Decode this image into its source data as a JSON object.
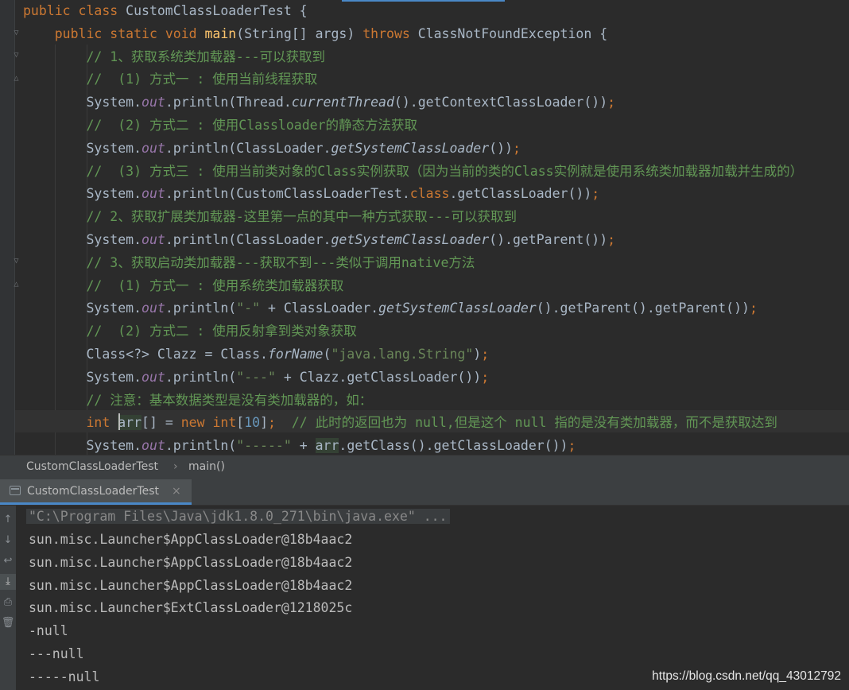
{
  "editor": {
    "lines": [
      {
        "t": [
          [
            "kw",
            "public class "
          ],
          [
            "",
            "CustomClassLoaderTest {"
          ]
        ]
      },
      {
        "t": [
          [
            "",
            "    "
          ],
          [
            "kw",
            "public static void "
          ],
          [
            "fn",
            "main"
          ],
          [
            "",
            "(String[] args) "
          ],
          [
            "kw",
            "throws "
          ],
          [
            "",
            "ClassNotFoundException {"
          ]
        ]
      },
      {
        "t": [
          [
            "",
            "        "
          ],
          [
            "cm",
            "// 1、获取系统类加载器---可以获取到"
          ]
        ]
      },
      {
        "t": [
          [
            "",
            "        "
          ],
          [
            "cm",
            "//  (1) 方式一 : 使用当前线程获取"
          ]
        ]
      },
      {
        "t": [
          [
            "",
            "        System."
          ],
          [
            "fld",
            "out"
          ],
          [
            "",
            ".println(Thread."
          ],
          [
            "it",
            "currentThread"
          ],
          [
            "",
            "().getContextClassLoader())"
          ],
          [
            "kw",
            ";"
          ]
        ]
      },
      {
        "t": [
          [
            "",
            "        "
          ],
          [
            "cm",
            "//  (2) 方式二 : 使用Classloader的静态方法获取"
          ]
        ]
      },
      {
        "t": [
          [
            "",
            "        System."
          ],
          [
            "fld",
            "out"
          ],
          [
            "",
            ".println(ClassLoader."
          ],
          [
            "it",
            "getSystemClassLoader"
          ],
          [
            "",
            "())"
          ],
          [
            "kw",
            ";"
          ]
        ]
      },
      {
        "t": [
          [
            "",
            "        "
          ],
          [
            "cm",
            "//  (3) 方式三 : 使用当前类对象的Class实例获取（因为当前的类的Class实例就是使用系统类加载器加载并生成的）"
          ]
        ]
      },
      {
        "t": [
          [
            "",
            "        System."
          ],
          [
            "fld",
            "out"
          ],
          [
            "",
            ".println(CustomClassLoaderTest."
          ],
          [
            "kw",
            "class"
          ],
          [
            "",
            ".getClassLoader())"
          ],
          [
            "kw",
            ";"
          ]
        ]
      },
      {
        "t": [
          [
            "",
            "        "
          ],
          [
            "cm",
            "// 2、获取扩展类加载器-这里第一点的其中一种方式获取---可以获取到"
          ]
        ]
      },
      {
        "t": [
          [
            "",
            "        System."
          ],
          [
            "fld",
            "out"
          ],
          [
            "",
            ".println(ClassLoader."
          ],
          [
            "it",
            "getSystemClassLoader"
          ],
          [
            "",
            "().getParent())"
          ],
          [
            "kw",
            ";"
          ]
        ]
      },
      {
        "t": [
          [
            "",
            "        "
          ],
          [
            "cm",
            "// 3、获取启动类加载器---获取不到---类似于调用native方法"
          ]
        ]
      },
      {
        "t": [
          [
            "",
            "        "
          ],
          [
            "cm",
            "//  (1) 方式一 : 使用系统类加载器获取"
          ]
        ]
      },
      {
        "t": [
          [
            "",
            "        System."
          ],
          [
            "fld",
            "out"
          ],
          [
            "",
            ".println("
          ],
          [
            "str",
            "\"-\" "
          ],
          [
            "",
            "+ ClassLoader."
          ],
          [
            "it",
            "getSystemClassLoader"
          ],
          [
            "",
            "().getParent().getParent())"
          ],
          [
            "kw",
            ";"
          ]
        ]
      },
      {
        "t": [
          [
            "",
            "        "
          ],
          [
            "cm",
            "//  (2) 方式二 : 使用反射拿到类对象获取"
          ]
        ]
      },
      {
        "t": [
          [
            "",
            "        Class<?> Clazz = Class."
          ],
          [
            "it",
            "forName"
          ],
          [
            "",
            "("
          ],
          [
            "str",
            "\"java.lang.String\""
          ],
          [
            "",
            ")"
          ],
          [
            "kw",
            ";"
          ]
        ]
      },
      {
        "t": [
          [
            "",
            "        System."
          ],
          [
            "fld",
            "out"
          ],
          [
            "",
            ".println("
          ],
          [
            "str",
            "\"---\" "
          ],
          [
            "",
            "+ Clazz.getClassLoader())"
          ],
          [
            "kw",
            ";"
          ]
        ]
      },
      {
        "t": [
          [
            "",
            "        "
          ],
          [
            "cm",
            "// 注意：基本数据类型是没有类加载器的，如："
          ]
        ]
      },
      {
        "t": [
          [
            "",
            "        "
          ],
          [
            "kw",
            "int "
          ],
          [
            "hl",
            "arr"
          ],
          [
            "",
            "[] = "
          ],
          [
            "kw",
            "new int"
          ],
          [
            "",
            "["
          ],
          [
            "num",
            "10"
          ],
          [
            "",
            "]"
          ],
          [
            "kw",
            ";  "
          ],
          [
            "cm",
            "// 此时的返回也为 null,但是这个 null 指的是没有类加载器，而不是获取达到"
          ]
        ]
      },
      {
        "t": [
          [
            "",
            "        System."
          ],
          [
            "fld",
            "out"
          ],
          [
            "",
            ".println("
          ],
          [
            "str",
            "\"-----\" "
          ],
          [
            "",
            "+ "
          ],
          [
            "hl",
            "arr"
          ],
          [
            "",
            ".getClass().getClassLoader())"
          ],
          [
            "kw",
            ";"
          ]
        ]
      }
    ]
  },
  "breadcrumb": {
    "class_name": "CustomClassLoaderTest",
    "separator": "›",
    "method_name": "main()"
  },
  "run_panel": {
    "tab_label": "CustomClassLoaderTest",
    "tab_close": "×",
    "command_line": "\"C:\\Program Files\\Java\\jdk1.8.0_271\\bin\\java.exe\" ...",
    "output": [
      "sun.misc.Launcher$AppClassLoader@18b4aac2",
      "sun.misc.Launcher$AppClassLoader@18b4aac2",
      "sun.misc.Launcher$AppClassLoader@18b4aac2",
      "sun.misc.Launcher$ExtClassLoader@1218025c",
      "-null",
      "---null",
      "-----null"
    ],
    "tools": [
      "arrow-up-icon",
      "arrow-down-icon",
      "soft-wrap-icon",
      "scroll-to-end-icon",
      "print-icon",
      "trash-icon"
    ]
  },
  "watermark": "https://blog.csdn.net/qq_43012792",
  "colors": {
    "background": "#2b2b2b",
    "keyword": "#cc7832",
    "method": "#ffc66d",
    "field": "#9876aa",
    "comment": "#629755",
    "string": "#6a8759",
    "number": "#6897bb",
    "text": "#a9b7c6",
    "accent": "#4a88c7"
  }
}
